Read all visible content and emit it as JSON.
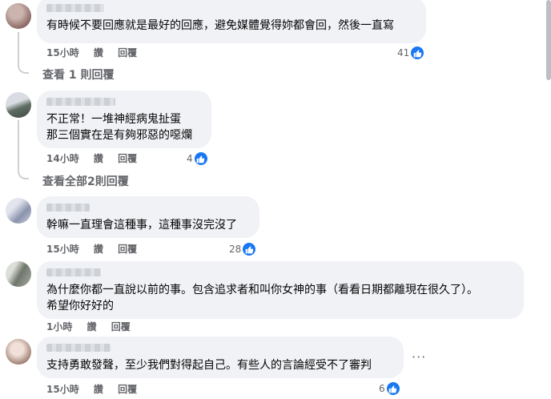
{
  "comments": [
    {
      "text_lines": [
        "有時候不要回應就是最好的回應，避免媒體覺得妳都會回，然後一直寫"
      ],
      "time": "15小時",
      "like_label": "讚",
      "reply_label": "回覆",
      "reactions": "41",
      "avatar_colors": [
        "#b9a39e",
        "#8e6b66"
      ]
    },
    {
      "text_lines": [
        "不正常！一堆神經病鬼扯蛋",
        "那三個實在是有夠邪惡的噁爛"
      ],
      "time": "14小時",
      "like_label": "讚",
      "reply_label": "回覆",
      "reactions": "4",
      "avatar_colors": [
        "#c8ccd3",
        "#5f6d63"
      ]
    },
    {
      "text_lines": [
        "幹嘛一直理會這種事，這種事沒完沒了"
      ],
      "time": "15小時",
      "like_label": "讚",
      "reply_label": "回覆",
      "reactions": "28",
      "avatar_colors": [
        "#d7dbe6",
        "#8a93ad"
      ]
    },
    {
      "text_lines": [
        "為什麼你都一直說以前的事。包含追求者和叫你女神的事（看看日期都離現在很久了）。",
        "希望你好好的"
      ],
      "time": "1小時",
      "like_label": "讚",
      "reply_label": "回覆",
      "reactions": "",
      "avatar_colors": [
        "#c6c8c2",
        "#6f766b"
      ]
    },
    {
      "text_lines": [
        "支持勇敢發聲，至少我們對得起自己。有些人的言論經受不了審判"
      ],
      "time": "15小時",
      "like_label": "讚",
      "reply_label": "回覆",
      "reactions": "6",
      "avatar_colors": [
        "#e3cfc7",
        "#9b7a6d"
      ]
    }
  ],
  "view_replies": [
    "查看 1 則回覆",
    "查看全部2則回覆"
  ],
  "more_glyph": "···",
  "colors": {
    "bubble": "#f0f2f5",
    "meta": "#65676b",
    "like_blue": "#1877f2"
  }
}
